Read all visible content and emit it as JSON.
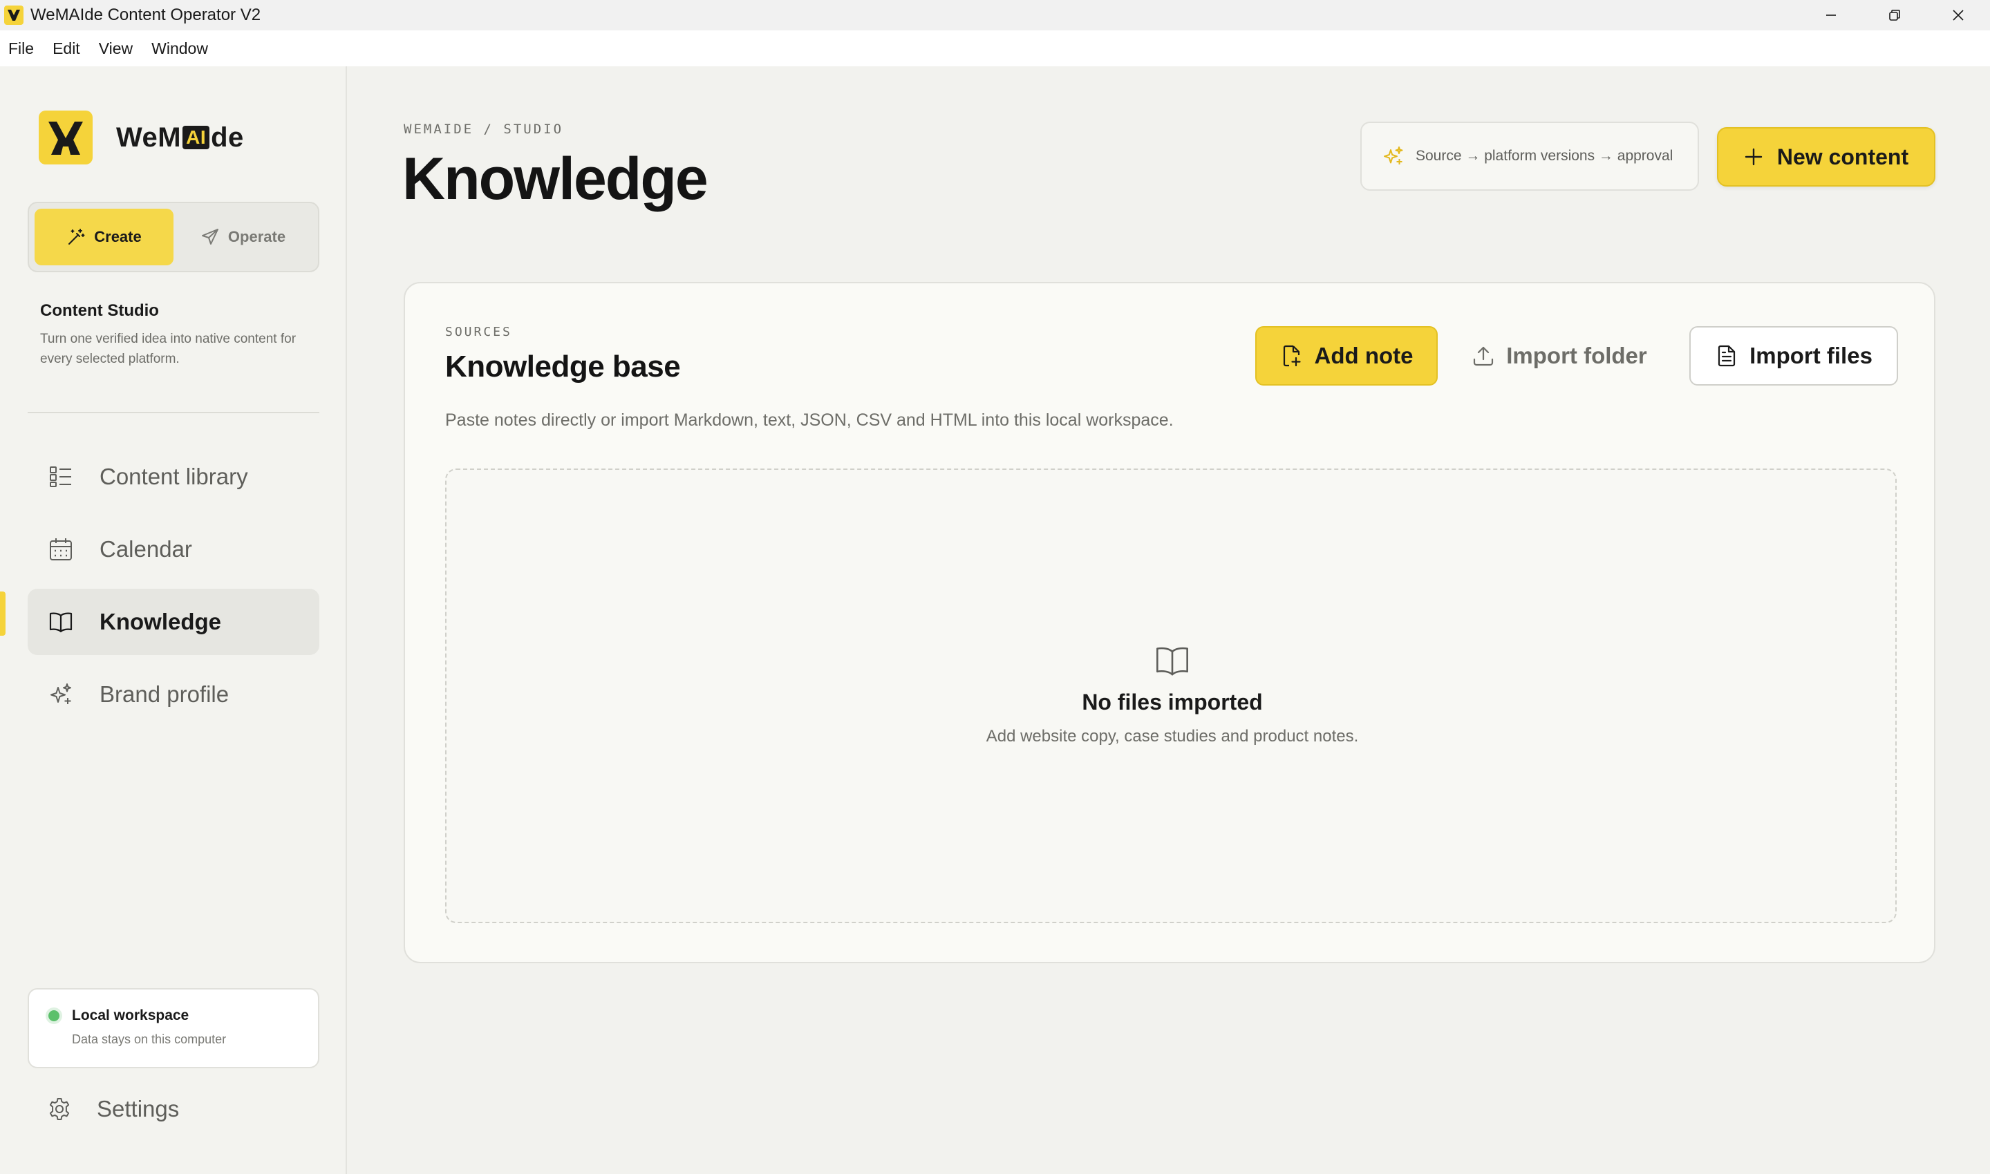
{
  "window": {
    "title": "WeMAIde Content Operator V2"
  },
  "menu": [
    "File",
    "Edit",
    "View",
    "Window"
  ],
  "brand": {
    "name_prefix": "WeM",
    "name_highlight": "AI",
    "name_suffix": "de",
    "accent": "#f5d33a"
  },
  "mode": {
    "create_label": "Create",
    "operate_label": "Operate",
    "active": "create"
  },
  "studio": {
    "title": "Content Studio",
    "description": "Turn one verified idea into native content for every selected platform."
  },
  "nav": {
    "items": [
      {
        "label": "Content library",
        "icon": "grid-list-icon"
      },
      {
        "label": "Calendar",
        "icon": "calendar-icon"
      },
      {
        "label": "Knowledge",
        "icon": "book-open-icon",
        "active": true
      },
      {
        "label": "Brand profile",
        "icon": "sparkles-icon"
      }
    ],
    "settings_label": "Settings"
  },
  "workspace": {
    "title": "Local workspace",
    "subtitle": "Data stays on this computer",
    "status_color": "#5cc06b"
  },
  "header": {
    "breadcrumb": "WEMAIDE / STUDIO",
    "title": "Knowledge",
    "flow_text": "Source → platform versions → approval",
    "new_button_label": "New content"
  },
  "knowledge": {
    "eyebrow": "SOURCES",
    "title": "Knowledge base",
    "description": "Paste notes directly or import Markdown, text, JSON, CSV and HTML into this local workspace.",
    "add_note_label": "Add note",
    "import_folder_label": "Import folder",
    "import_files_label": "Import files",
    "empty_title": "No files imported",
    "empty_subtitle": "Add website copy, case studies and product notes."
  }
}
